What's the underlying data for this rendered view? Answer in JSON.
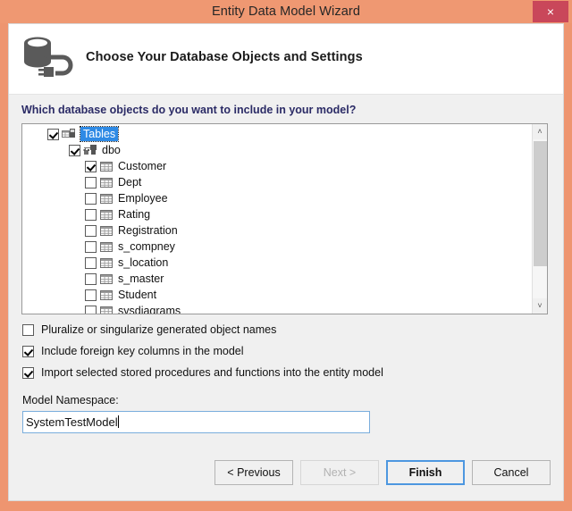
{
  "window": {
    "title": "Entity Data Model Wizard",
    "close_label": "×",
    "close_icon": "close-icon",
    "accent_color": "#ef9872",
    "close_button_color": "#c9475a"
  },
  "header": {
    "icon": "database-connection-icon",
    "title": "Choose Your Database Objects and Settings"
  },
  "body": {
    "prompt": "Which database objects do you want to include in your model?",
    "prompt_color": "#2b2b66"
  },
  "tree": {
    "selection_color": "#2e8ae5",
    "nodes": [
      {
        "label": "Tables",
        "level": 0,
        "checked": true,
        "selected": true,
        "icon": "tables-folder-icon"
      },
      {
        "label": "dbo",
        "level": 1,
        "checked": true,
        "selected": false,
        "icon": "schema-icon"
      },
      {
        "label": "Customer",
        "level": 2,
        "checked": true,
        "selected": false,
        "icon": "table-icon"
      },
      {
        "label": "Dept",
        "level": 2,
        "checked": false,
        "selected": false,
        "icon": "table-icon"
      },
      {
        "label": "Employee",
        "level": 2,
        "checked": false,
        "selected": false,
        "icon": "table-icon"
      },
      {
        "label": "Rating",
        "level": 2,
        "checked": false,
        "selected": false,
        "icon": "table-icon"
      },
      {
        "label": "Registration",
        "level": 2,
        "checked": false,
        "selected": false,
        "icon": "table-icon"
      },
      {
        "label": "s_compney",
        "level": 2,
        "checked": false,
        "selected": false,
        "icon": "table-icon"
      },
      {
        "label": "s_location",
        "level": 2,
        "checked": false,
        "selected": false,
        "icon": "table-icon"
      },
      {
        "label": "s_master",
        "level": 2,
        "checked": false,
        "selected": false,
        "icon": "table-icon"
      },
      {
        "label": "Student",
        "level": 2,
        "checked": false,
        "selected": false,
        "icon": "table-icon"
      },
      {
        "label": "sysdiagrams",
        "level": 2,
        "checked": false,
        "selected": false,
        "icon": "table-icon"
      }
    ],
    "scrollbar": {
      "up_arrow": "˄",
      "down_arrow": "˅"
    }
  },
  "options": [
    {
      "label": "Pluralize or singularize generated object names",
      "checked": false
    },
    {
      "label": "Include foreign key columns in the model",
      "checked": true
    },
    {
      "label": "Import selected stored procedures and functions into the entity model",
      "checked": true
    }
  ],
  "namespace": {
    "label": "Model Namespace:",
    "value": "SystemTestModel",
    "placeholder": ""
  },
  "buttons": {
    "previous": "< Previous",
    "next": "Next >",
    "finish": "Finish",
    "cancel": "Cancel"
  }
}
